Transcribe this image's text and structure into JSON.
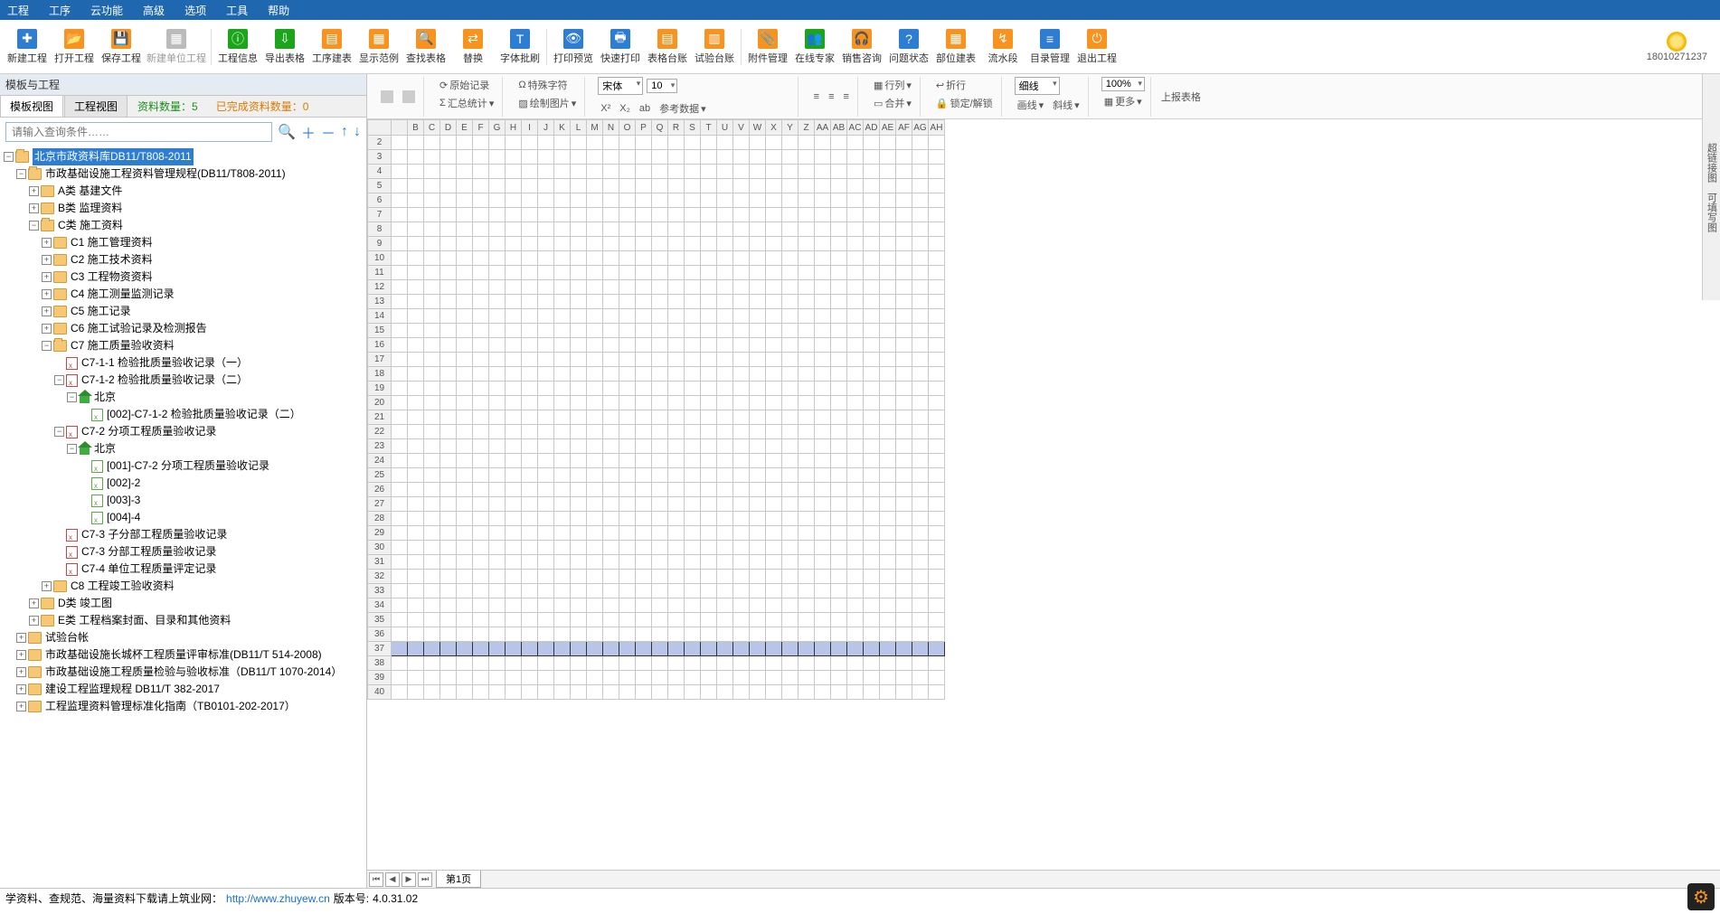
{
  "menu": [
    "工程",
    "工序",
    "云功能",
    "高级",
    "选项",
    "工具",
    "帮助"
  ],
  "toolbar": [
    {
      "label": "新建工程",
      "color": "#2d7dd2",
      "glyph": "✚"
    },
    {
      "label": "打开工程",
      "color": "#f7931e",
      "glyph": "📂"
    },
    {
      "label": "保存工程",
      "color": "#f7931e",
      "glyph": "💾"
    },
    {
      "label": "新建单位工程",
      "color": "#bbb",
      "glyph": "▦",
      "dim": true,
      "wide": true
    },
    {
      "sep": true
    },
    {
      "label": "工程信息",
      "color": "#1aa51a",
      "glyph": "ⓘ"
    },
    {
      "label": "导出表格",
      "color": "#1aa51a",
      "glyph": "⇩",
      "dd": true
    },
    {
      "label": "工序建表",
      "color": "#f7931e",
      "glyph": "▤"
    },
    {
      "label": "显示范例",
      "color": "#f7931e",
      "glyph": "▦"
    },
    {
      "label": "查找表格",
      "color": "#f7931e",
      "glyph": "🔍"
    },
    {
      "label": "替换",
      "color": "#f7931e",
      "glyph": "⇄"
    },
    {
      "label": "字体批刷",
      "color": "#2d7dd2",
      "glyph": "T"
    },
    {
      "sep": true
    },
    {
      "label": "打印预览",
      "color": "#2d7dd2",
      "glyph": "👁"
    },
    {
      "label": "快速打印",
      "color": "#2d7dd2",
      "glyph": "🖶",
      "dd": true
    },
    {
      "label": "表格台账",
      "color": "#f7931e",
      "glyph": "▤",
      "dd": true
    },
    {
      "label": "试验台账",
      "color": "#f7931e",
      "glyph": "▥"
    },
    {
      "sep": true
    },
    {
      "label": "附件管理",
      "color": "#f7931e",
      "glyph": "📎"
    },
    {
      "label": "在线专家",
      "color": "#1aa51a",
      "glyph": "👥"
    },
    {
      "label": "销售咨询",
      "color": "#f7931e",
      "glyph": "🎧"
    },
    {
      "label": "问题状态",
      "color": "#2d7dd2",
      "glyph": "?"
    },
    {
      "label": "部位建表",
      "color": "#f7931e",
      "glyph": "▦"
    },
    {
      "label": "流水段",
      "color": "#f7931e",
      "glyph": "↯"
    },
    {
      "label": "目录管理",
      "color": "#2d7dd2",
      "glyph": "≡"
    },
    {
      "label": "退出工程",
      "color": "#f7931e",
      "glyph": "⏻"
    }
  ],
  "user_phone": "18010271237",
  "pane_title": "模板与工程",
  "tabs": {
    "t1": "模板视图",
    "t2": "工程视图"
  },
  "stats": {
    "count_lbl": "资料数量：",
    "count_val": "5",
    "done_lbl": "已完成资料数量：",
    "done_val": "0"
  },
  "search": {
    "placeholder": "请输入查询条件……"
  },
  "tree": {
    "root": "北京市政资料库DB11/T808-2011",
    "n1": "市政基础设施工程资料管理规程(DB11/T808-2011)",
    "a": "A类 基建文件",
    "b": "B类 监理资料",
    "c": "C类 施工资料",
    "c1": "C1 施工管理资料",
    "c2": "C2 施工技术资料",
    "c3": "C3 工程物资资料",
    "c4": "C4 施工测量监测记录",
    "c5": "C5 施工记录",
    "c6": "C6 施工试验记录及检测报告",
    "c7": "C7 施工质量验收资料",
    "c711": "C7-1-1 检验批质量验收记录（一）",
    "c712": "C7-1-2 检验批质量验收记录（二）",
    "bj1": "北京",
    "d712": "[002]-C7-1-2 检验批质量验收记录（二）",
    "c72": "C7-2 分项工程质量验收记录",
    "bj2": "北京",
    "d721": "[001]-C7-2 分项工程质量验收记录",
    "d722": "[002]-2",
    "d723": "[003]-3",
    "d724": "[004]-4",
    "c73a": "C7-3 子分部工程质量验收记录",
    "c73b": "C7-3 分部工程质量验收记录",
    "c74": "C7-4 单位工程质量评定记录",
    "c8": "C8 工程竣工验收资料",
    "d": "D类 竣工图",
    "e": "E类 工程档案封面、目录和其他资料",
    "n2": "试验台帐",
    "n3": "市政基础设施长城杯工程质量评审标准(DB11/T 514-2008)",
    "n4": "市政基础设施工程质量检验与验收标准（DB11/T 1070-2014）",
    "n5": "建设工程监理规程 DB11/T 382-2017",
    "n6": "工程监理资料管理标准化指南（TB0101-202-2017）"
  },
  "ss": {
    "orig": "原始记录",
    "sum": "汇总统计",
    "spec": "特殊字符",
    "draw": "绘制图片",
    "sub": "x₂",
    "params": "参考数据",
    "font": "宋体",
    "size": "10",
    "rowh": "行列",
    "merge": "合并",
    "wrap": "折行",
    "lock": "锁定/解锁",
    "line": "细线",
    "bline": "画线",
    "slash": "斜线",
    "zoom": "100%",
    "more": "更多",
    "upload": "上报表格"
  },
  "cols": [
    "",
    "B",
    "C",
    "D",
    "E",
    "F",
    "G",
    "H",
    "I",
    "J",
    "K",
    "L",
    "M",
    "N",
    "O",
    "P",
    "Q",
    "R",
    "S",
    "T",
    "U",
    "V",
    "W",
    "X",
    "Y",
    "Z",
    "AA",
    "AB",
    "AC",
    "AD",
    "AE",
    "AF",
    "AG",
    "AH"
  ],
  "rows": [
    2,
    3,
    4,
    5,
    6,
    7,
    8,
    9,
    10,
    11,
    12,
    13,
    14,
    15,
    16,
    17,
    18,
    19,
    20,
    21,
    22,
    23,
    24,
    25,
    26,
    27,
    28,
    29,
    30,
    31,
    32,
    33,
    34,
    35,
    36,
    37,
    38,
    39,
    40
  ],
  "selected_row": 37,
  "sheet": "第1页",
  "rside": {
    "a": "超链接图",
    "b": "可填写图"
  },
  "status": {
    "pre": "学资料、查规范、海量资料下载请上筑业网：",
    "url": "http://www.zhuyew.cn",
    "ver_lbl": "版本号:",
    "ver": "4.0.31.02"
  }
}
